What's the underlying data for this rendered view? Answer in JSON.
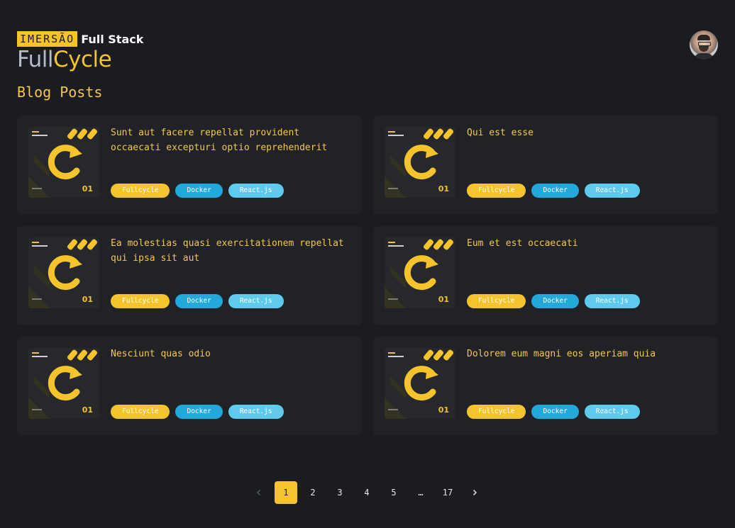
{
  "header": {
    "logo_imersao": "IMERSÃO",
    "logo_fullstack": "Full Stack",
    "logo_full": "Full",
    "logo_cycle": "Cycle"
  },
  "page_title": "Blog Posts",
  "posts": [
    {
      "title": "Sunt aut facere repellat provident occaecati excepturi optio reprehenderit",
      "tags": [
        "Fullcycle",
        "Docker",
        "React.js"
      ],
      "thumb_badge": "01"
    },
    {
      "title": "Qui est esse",
      "tags": [
        "Fullcycle",
        "Docker",
        "React.js"
      ],
      "thumb_badge": "01"
    },
    {
      "title": "Ea molestias quasi exercitationem repellat qui ipsa sit aut",
      "tags": [
        "Fullcycle",
        "Docker",
        "React.js"
      ],
      "thumb_badge": "01"
    },
    {
      "title": "Eum et est occaecati",
      "tags": [
        "Fullcycle",
        "Docker",
        "React.js"
      ],
      "thumb_badge": "01"
    },
    {
      "title": "Nesciunt quas odio",
      "tags": [
        "Fullcycle",
        "Docker",
        "React.js"
      ],
      "thumb_badge": "01"
    },
    {
      "title": "Dolorem eum magni eos aperiam quia",
      "tags": [
        "Fullcycle",
        "Docker",
        "React.js"
      ],
      "thumb_badge": "01"
    }
  ],
  "pagination": {
    "prev_icon": "chevron-left-icon",
    "pages": [
      "1",
      "2",
      "3",
      "4",
      "5",
      "…",
      "17"
    ],
    "current": "1",
    "next_icon": "chevron-right-icon"
  },
  "colors": {
    "background": "#1a1c21",
    "card": "#202227",
    "accent": "#f5c42c",
    "docker": "#23a8dc",
    "react": "#5ecbee"
  }
}
